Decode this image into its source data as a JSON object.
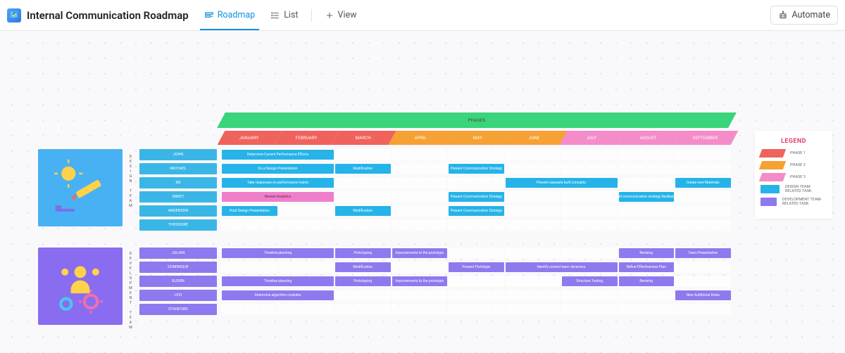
{
  "header": {
    "title": "Internal Communication Roadmap",
    "tabs": {
      "roadmap": "Roadmap",
      "list": "List",
      "view": "View"
    },
    "automate": "Automate"
  },
  "phases_band_label": "PHASES",
  "months": [
    "JANUARY",
    "FEBRUARY",
    "MARCH",
    "APRIL",
    "MAY",
    "JUNE",
    "JULY",
    "AUGUST",
    "SEPTEMBER"
  ],
  "month_phase": [
    "p1",
    "p1",
    "p1",
    "p2",
    "p2",
    "p2",
    "p3",
    "p3",
    "p3"
  ],
  "teams": {
    "design": {
      "vlabel": "DESIGN TEAM",
      "people": [
        "JOHN",
        "MICHAEL",
        "KD",
        "MIKEY",
        "ANDERSON",
        "THEODORE"
      ],
      "tasks": [
        {
          "row": 0,
          "start": 0,
          "span": 2,
          "colorClass": "c-design",
          "label": "Determine Current Performance Efforts"
        },
        {
          "row": 1,
          "start": 0,
          "span": 2,
          "colorClass": "c-design",
          "label": "Do a Design Presentation"
        },
        {
          "row": 1,
          "start": 2,
          "span": 1,
          "colorClass": "c-design",
          "label": "Modification"
        },
        {
          "row": 1,
          "start": 4,
          "span": 1,
          "colorClass": "c-design",
          "label": "Present Communication Strategy"
        },
        {
          "row": 2,
          "start": 0,
          "span": 2,
          "colorClass": "c-design",
          "label": "Take responses on performance matrix"
        },
        {
          "row": 2,
          "start": 5,
          "span": 2,
          "colorClass": "c-design",
          "label": "Present separate built concepts"
        },
        {
          "row": 2,
          "start": 8,
          "span": 1,
          "colorClass": "c-design",
          "label": "Create new Materials"
        },
        {
          "row": 3,
          "start": 0,
          "span": 2,
          "colorClass": "c-pink",
          "label": "Review Analytics"
        },
        {
          "row": 3,
          "start": 4,
          "span": 1,
          "colorClass": "c-design",
          "label": "Present Communication Strategy"
        },
        {
          "row": 3,
          "start": 7,
          "span": 1,
          "colorClass": "c-design",
          "label": "Get communication strategy feedback"
        },
        {
          "row": 4,
          "start": 0,
          "span": 1,
          "colorClass": "c-design",
          "label": "Host Design Presentation"
        },
        {
          "row": 4,
          "start": 2,
          "span": 1,
          "colorClass": "c-design",
          "label": "Modification"
        },
        {
          "row": 4,
          "start": 4,
          "span": 1,
          "colorClass": "c-design",
          "label": "Present Communication Strategy"
        }
      ]
    },
    "dev": {
      "vlabel": "DEVELOPMENT TEAM",
      "people": [
        "JULIAN",
        "DOMINIQUE",
        "BJORN",
        "LEVI",
        "STANFORD"
      ],
      "tasks": [
        {
          "row": 0,
          "start": 0,
          "span": 2,
          "colorClass": "c-dev",
          "label": "Timeline planning"
        },
        {
          "row": 0,
          "start": 2,
          "span": 1,
          "colorClass": "c-dev",
          "label": "Prototyping"
        },
        {
          "row": 0,
          "start": 3,
          "span": 1,
          "colorClass": "c-dev",
          "label": "Improvements to the prototype"
        },
        {
          "row": 0,
          "start": 7,
          "span": 1,
          "colorClass": "c-dev",
          "label": "Revising"
        },
        {
          "row": 0,
          "start": 8,
          "span": 1,
          "colorClass": "c-dev",
          "label": "Team Presentation"
        },
        {
          "row": 1,
          "start": 2,
          "span": 1,
          "colorClass": "c-dev",
          "label": "Modification"
        },
        {
          "row": 1,
          "start": 4,
          "span": 1,
          "colorClass": "c-dev",
          "label": "Present Prototype"
        },
        {
          "row": 1,
          "start": 5,
          "span": 2,
          "colorClass": "c-dev",
          "label": "Identify current team dynamics"
        },
        {
          "row": 1,
          "start": 7,
          "span": 1,
          "colorClass": "c-dev",
          "label": "Refine Effectiveness Plan"
        },
        {
          "row": 2,
          "start": 0,
          "span": 2,
          "colorClass": "c-dev",
          "label": "Timeline planning"
        },
        {
          "row": 2,
          "start": 2,
          "span": 1,
          "colorClass": "c-dev",
          "label": "Prototyping"
        },
        {
          "row": 2,
          "start": 3,
          "span": 1,
          "colorClass": "c-dev",
          "label": "Improvements to the prototype"
        },
        {
          "row": 2,
          "start": 6,
          "span": 1,
          "colorClass": "c-dev",
          "label": "Structure Testing"
        },
        {
          "row": 2,
          "start": 7,
          "span": 1,
          "colorClass": "c-dev",
          "label": "Revising"
        },
        {
          "row": 3,
          "start": 0,
          "span": 2,
          "colorClass": "c-dev",
          "label": "Determine algorithm modules"
        },
        {
          "row": 3,
          "start": 8,
          "span": 1,
          "colorClass": "c-dev",
          "label": "New Additional Roles"
        }
      ]
    }
  },
  "legend": {
    "title": "LEGEND",
    "items": [
      {
        "label": "PHASE 1",
        "color": "#f0625c",
        "skew": true
      },
      {
        "label": "PHASE 2",
        "color": "#f5a133",
        "skew": true
      },
      {
        "label": "PHASE 3",
        "color": "#f48cc9",
        "skew": true
      },
      {
        "label": "DESIGN TEAM-RELATED TASK",
        "color": "#25b3e8",
        "skew": false
      },
      {
        "label": "DEVELOPMENT TEAM-RELATED TASK",
        "color": "#8f79ee",
        "skew": false
      }
    ]
  },
  "chart_data": {
    "type": "gantt",
    "title": "Internal Communication Roadmap",
    "x_categories": [
      "January",
      "February",
      "March",
      "April",
      "May",
      "June",
      "July",
      "August",
      "September"
    ],
    "phase_map": {
      "January": "Phase 1",
      "February": "Phase 1",
      "March": "Phase 1",
      "April": "Phase 2",
      "May": "Phase 2",
      "June": "Phase 2",
      "July": "Phase 3",
      "August": "Phase 3",
      "September": "Phase 3"
    },
    "groups": [
      {
        "group": "Design Team",
        "rows": [
          {
            "owner": "John",
            "bars": [
              {
                "start": "January",
                "span_months": 2,
                "label": "Determine Current Performance Efforts"
              }
            ]
          },
          {
            "owner": "Michael",
            "bars": [
              {
                "start": "January",
                "span_months": 2,
                "label": "Do a Design Presentation"
              },
              {
                "start": "March",
                "span_months": 1,
                "label": "Modification"
              },
              {
                "start": "May",
                "span_months": 1,
                "label": "Present Communication Strategy"
              }
            ]
          },
          {
            "owner": "KD",
            "bars": [
              {
                "start": "January",
                "span_months": 2,
                "label": "Take responses on performance matrix"
              },
              {
                "start": "June",
                "span_months": 2,
                "label": "Present separate built concepts"
              },
              {
                "start": "September",
                "span_months": 1,
                "label": "Create new Materials"
              }
            ]
          },
          {
            "owner": "Mikey",
            "bars": [
              {
                "start": "January",
                "span_months": 2,
                "label": "Review Analytics",
                "note": "highlighted"
              },
              {
                "start": "May",
                "span_months": 1,
                "label": "Present Communication Strategy"
              },
              {
                "start": "August",
                "span_months": 1,
                "label": "Get communication strategy feedback"
              }
            ]
          },
          {
            "owner": "Anderson",
            "bars": [
              {
                "start": "January",
                "span_months": 1,
                "label": "Host Design Presentation"
              },
              {
                "start": "March",
                "span_months": 1,
                "label": "Modification"
              },
              {
                "start": "May",
                "span_months": 1,
                "label": "Present Communication Strategy"
              }
            ]
          },
          {
            "owner": "Theodore",
            "bars": []
          }
        ]
      },
      {
        "group": "Development Team",
        "rows": [
          {
            "owner": "Julian",
            "bars": [
              {
                "start": "January",
                "span_months": 2,
                "label": "Timeline planning"
              },
              {
                "start": "March",
                "span_months": 1,
                "label": "Prototyping"
              },
              {
                "start": "April",
                "span_months": 1,
                "label": "Improvements to the prototype"
              },
              {
                "start": "August",
                "span_months": 1,
                "label": "Revising"
              },
              {
                "start": "September",
                "span_months": 1,
                "label": "Team Presentation"
              }
            ]
          },
          {
            "owner": "Dominique",
            "bars": [
              {
                "start": "March",
                "span_months": 1,
                "label": "Modification"
              },
              {
                "start": "May",
                "span_months": 1,
                "label": "Present Prototype"
              },
              {
                "start": "June",
                "span_months": 2,
                "label": "Identify current team dynamics"
              },
              {
                "start": "August",
                "span_months": 1,
                "label": "Refine Effectiveness Plan"
              }
            ]
          },
          {
            "owner": "Bjorn",
            "bars": [
              {
                "start": "January",
                "span_months": 2,
                "label": "Timeline planning"
              },
              {
                "start": "March",
                "span_months": 1,
                "label": "Prototyping"
              },
              {
                "start": "April",
                "span_months": 1,
                "label": "Improvements to the prototype"
              },
              {
                "start": "July",
                "span_months": 1,
                "label": "Structure Testing"
              },
              {
                "start": "August",
                "span_months": 1,
                "label": "Revising"
              }
            ]
          },
          {
            "owner": "Levi",
            "bars": [
              {
                "start": "January",
                "span_months": 2,
                "label": "Determine algorithm modules"
              },
              {
                "start": "September",
                "span_months": 1,
                "label": "New Additional Roles"
              }
            ]
          },
          {
            "owner": "Stanford",
            "bars": []
          }
        ]
      }
    ]
  }
}
